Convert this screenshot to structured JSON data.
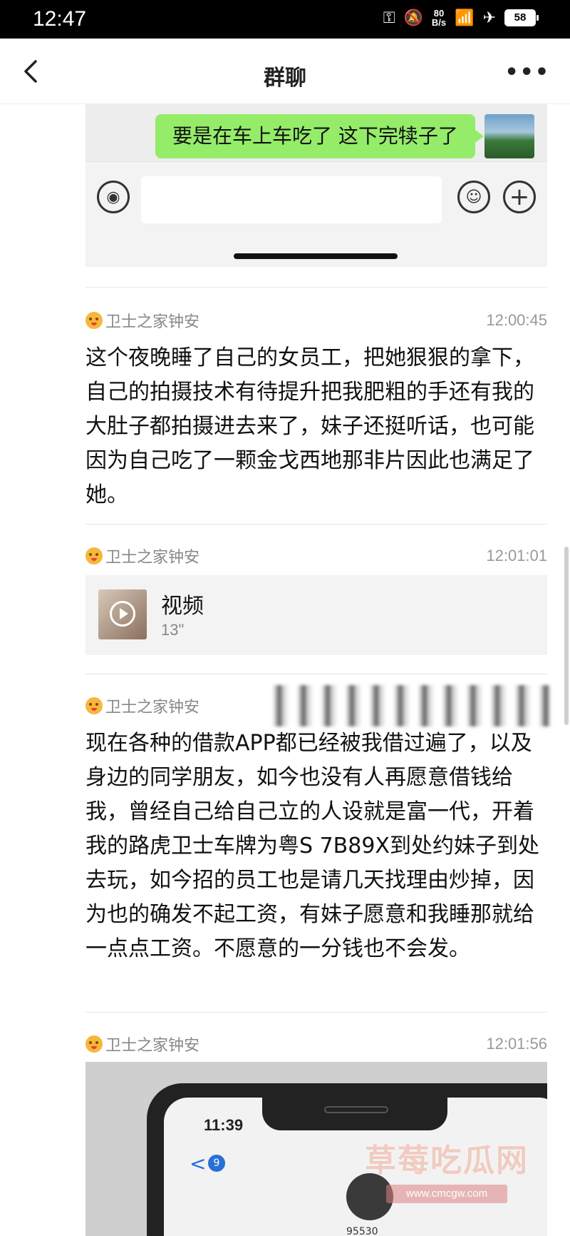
{
  "status_bar": {
    "time": "12:47",
    "speed_value": "80",
    "speed_unit": "B/s",
    "battery": "58"
  },
  "nav": {
    "title": "群聊",
    "back_icon": "chevron-left-icon",
    "more_icon": "more-dots-icon"
  },
  "embedded_screenshot": {
    "bubble_text": "要是在车上车吃了 这下完犊子了",
    "bubble_color": "#95ec69"
  },
  "messages": [
    {
      "sender": "卫士之家钟安",
      "time": "12:00:45",
      "text": "这个夜晚睡了自己的女员工，把她狠狠的拿下，自己的拍摄技术有待提升把我肥粗的手还有我的大肚子都拍摄进去来了，妹子还挺听话，也可能因为自己吃了一颗金戈西地那非片因此也满足了她。"
    },
    {
      "sender": "卫士之家钟安",
      "time": "12:01:01",
      "video_label": "视频",
      "video_duration": "13\""
    },
    {
      "sender": "卫士之家钟安",
      "time": "",
      "text": "现在各种的借款APP都已经被我借过遍了，以及身边的同学朋友，如今也没有人再愿意借钱给我，曾经自己给自己立的人设就是富一代，开着我的路虎卫士车牌为粤S 7B89X到处约妹子到处去玩，如今招的员工也是请几天找理由炒掉，因为也的确发不起工资，有妹子愿意和我睡那就给一点点工资。不愿意的一分钱也不会发。"
    },
    {
      "sender": "卫士之家钟安",
      "time": "12:01:56"
    }
  ],
  "photo": {
    "phone_time": "11:39",
    "badge": "9",
    "number": "95530"
  },
  "watermark": {
    "title": "草莓吃瓜网",
    "url": "www.cmcgw.com"
  }
}
